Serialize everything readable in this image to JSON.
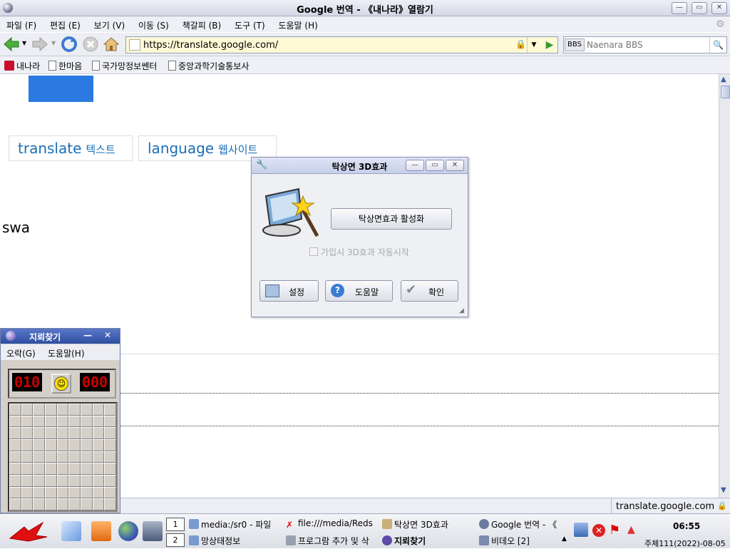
{
  "window": {
    "title": "Google 번역 - 《내나라》열람기"
  },
  "menu": [
    "파일 (F)",
    "편집 (E)",
    "보기 (V)",
    "이동 (S)",
    "책갈피 (B)",
    "도구 (T)",
    "도움말 (H)"
  ],
  "nav": {
    "url": "https://translate.google.com/",
    "search_engine": "BBS",
    "search_placeholder": "Naenara BBS"
  },
  "bookmarks": [
    "내나라",
    "한마음",
    "국가망정보쎈터",
    "중앙과학기술통보사"
  ],
  "page": {
    "tabs": [
      {
        "en": "translate",
        "ko": "텍스트"
      },
      {
        "en": "language",
        "ko": "웹사이트"
      }
    ],
    "partial_text": "swa"
  },
  "status": {
    "url": "translate.google.com"
  },
  "dialog": {
    "title": "탁상면 3D효과",
    "activate_label": "탁상면효과 활성화",
    "autostart_label": "가입시 3D효과 자동시작",
    "settings_label": "설정",
    "help_label": "도움말",
    "ok_label": "확인"
  },
  "minesweeper": {
    "title": "지뢰찾기",
    "menu": [
      "오락(G)",
      "도움말(H)"
    ],
    "mines_left": "010",
    "timer": "000"
  },
  "taskbar": {
    "workspace_1": "1",
    "workspace_2": "2",
    "row1": [
      "media:/sr0 - 파일",
      "file:///media/Reds",
      "탁상면 3D효과",
      "Google 번역 - 《"
    ],
    "row2": [
      "망상태정보",
      "프로그람 추가 및 삭",
      "지뢰찾기",
      "비데오 [2]"
    ],
    "time": "06:55",
    "date": "주체111(2022)-08-05"
  },
  "colors": {
    "accent_blue": "#2a7ae2",
    "link_blue": "#1a6eb5"
  }
}
